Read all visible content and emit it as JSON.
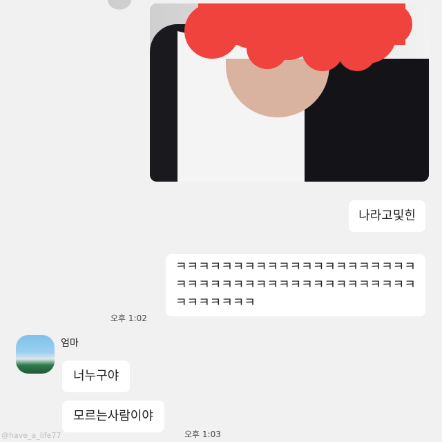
{
  "messages": {
    "sent_1": "나라고및힌",
    "sent_2": "ㅋㅋㅋㅋㅋㅋㅋㅋㅋㅋㅋㅋㅋㅋㅋㅋㅋㅋㅋㅋㅋㅋㅋㅋㅋㅋㅋㅋㅋㅋㅋㅋㅋㅋㅋㅋㅋㅋㅋㅋㅋㅋㅋㅋㅋㅋㅋㅋㅋ",
    "sent_time": "오후 1:02",
    "sender_name": "엄마",
    "recv_1": "너누구야",
    "recv_2": "모르는사람이야",
    "recv_time": "오후 1:03"
  },
  "watermark": "@have_a_life77",
  "colors": {
    "background": "#f1f1f1",
    "bubble": "#ffffff",
    "redaction": "#f0433d"
  }
}
